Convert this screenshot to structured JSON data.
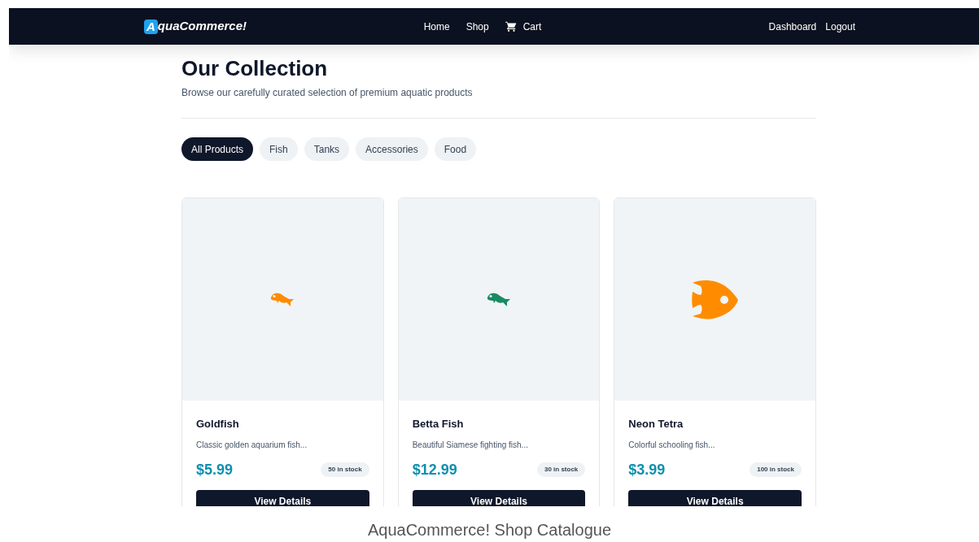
{
  "nav": {
    "logo_letter": "A",
    "logo_rest": "quaCommerce!",
    "links": [
      "Home",
      "Shop",
      "Cart"
    ],
    "account": [
      "Dashboard",
      "Logout"
    ]
  },
  "header": {
    "title": "Our Collection",
    "subtitle": "Browse our carefully curated selection of premium aquatic products"
  },
  "filters": [
    {
      "label": "All Products",
      "selected": true
    },
    {
      "label": "Fish",
      "selected": false
    },
    {
      "label": "Tanks",
      "selected": false
    },
    {
      "label": "Accessories",
      "selected": false
    },
    {
      "label": "Food",
      "selected": false
    }
  ],
  "products": [
    {
      "name": "Goldfish",
      "description": "Classic golden aquarium fish...",
      "price": "$5.99",
      "stock": "50 in stock",
      "button": "View Details",
      "kind": "small",
      "color": "#ff8c00"
    },
    {
      "name": "Betta Fish",
      "description": "Beautiful Siamese fighting fish...",
      "price": "$12.99",
      "stock": "30 in stock",
      "button": "View Details",
      "kind": "small",
      "color": "#1a8a63"
    },
    {
      "name": "Neon Tetra",
      "description": "Colorful schooling fish...",
      "price": "$3.99",
      "stock": "100 in stock",
      "button": "View Details",
      "kind": "large",
      "color": "#ff8c00"
    }
  ],
  "caption": "AquaCommerce! Shop Catalogue"
}
